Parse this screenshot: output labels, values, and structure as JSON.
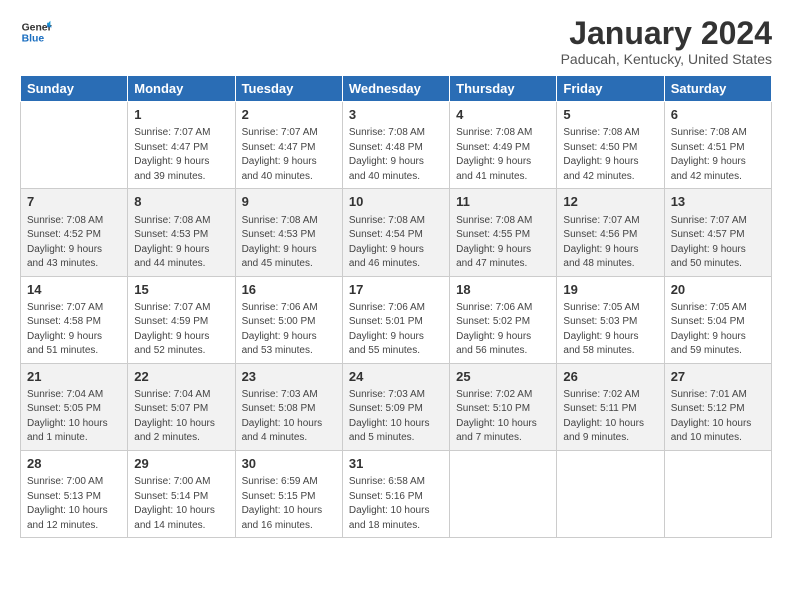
{
  "logo": {
    "line1": "General",
    "line2": "Blue"
  },
  "title": "January 2024",
  "subtitle": "Paducah, Kentucky, United States",
  "days_of_week": [
    "Sunday",
    "Monday",
    "Tuesday",
    "Wednesday",
    "Thursday",
    "Friday",
    "Saturday"
  ],
  "weeks": [
    [
      {
        "day": "",
        "content": ""
      },
      {
        "day": "1",
        "content": "Sunrise: 7:07 AM\nSunset: 4:47 PM\nDaylight: 9 hours\nand 39 minutes."
      },
      {
        "day": "2",
        "content": "Sunrise: 7:07 AM\nSunset: 4:47 PM\nDaylight: 9 hours\nand 40 minutes."
      },
      {
        "day": "3",
        "content": "Sunrise: 7:08 AM\nSunset: 4:48 PM\nDaylight: 9 hours\nand 40 minutes."
      },
      {
        "day": "4",
        "content": "Sunrise: 7:08 AM\nSunset: 4:49 PM\nDaylight: 9 hours\nand 41 minutes."
      },
      {
        "day": "5",
        "content": "Sunrise: 7:08 AM\nSunset: 4:50 PM\nDaylight: 9 hours\nand 42 minutes."
      },
      {
        "day": "6",
        "content": "Sunrise: 7:08 AM\nSunset: 4:51 PM\nDaylight: 9 hours\nand 42 minutes."
      }
    ],
    [
      {
        "day": "7",
        "content": "Sunrise: 7:08 AM\nSunset: 4:52 PM\nDaylight: 9 hours\nand 43 minutes."
      },
      {
        "day": "8",
        "content": "Sunrise: 7:08 AM\nSunset: 4:53 PM\nDaylight: 9 hours\nand 44 minutes."
      },
      {
        "day": "9",
        "content": "Sunrise: 7:08 AM\nSunset: 4:53 PM\nDaylight: 9 hours\nand 45 minutes."
      },
      {
        "day": "10",
        "content": "Sunrise: 7:08 AM\nSunset: 4:54 PM\nDaylight: 9 hours\nand 46 minutes."
      },
      {
        "day": "11",
        "content": "Sunrise: 7:08 AM\nSunset: 4:55 PM\nDaylight: 9 hours\nand 47 minutes."
      },
      {
        "day": "12",
        "content": "Sunrise: 7:07 AM\nSunset: 4:56 PM\nDaylight: 9 hours\nand 48 minutes."
      },
      {
        "day": "13",
        "content": "Sunrise: 7:07 AM\nSunset: 4:57 PM\nDaylight: 9 hours\nand 50 minutes."
      }
    ],
    [
      {
        "day": "14",
        "content": "Sunrise: 7:07 AM\nSunset: 4:58 PM\nDaylight: 9 hours\nand 51 minutes."
      },
      {
        "day": "15",
        "content": "Sunrise: 7:07 AM\nSunset: 4:59 PM\nDaylight: 9 hours\nand 52 minutes."
      },
      {
        "day": "16",
        "content": "Sunrise: 7:06 AM\nSunset: 5:00 PM\nDaylight: 9 hours\nand 53 minutes."
      },
      {
        "day": "17",
        "content": "Sunrise: 7:06 AM\nSunset: 5:01 PM\nDaylight: 9 hours\nand 55 minutes."
      },
      {
        "day": "18",
        "content": "Sunrise: 7:06 AM\nSunset: 5:02 PM\nDaylight: 9 hours\nand 56 minutes."
      },
      {
        "day": "19",
        "content": "Sunrise: 7:05 AM\nSunset: 5:03 PM\nDaylight: 9 hours\nand 58 minutes."
      },
      {
        "day": "20",
        "content": "Sunrise: 7:05 AM\nSunset: 5:04 PM\nDaylight: 9 hours\nand 59 minutes."
      }
    ],
    [
      {
        "day": "21",
        "content": "Sunrise: 7:04 AM\nSunset: 5:05 PM\nDaylight: 10 hours\nand 1 minute."
      },
      {
        "day": "22",
        "content": "Sunrise: 7:04 AM\nSunset: 5:07 PM\nDaylight: 10 hours\nand 2 minutes."
      },
      {
        "day": "23",
        "content": "Sunrise: 7:03 AM\nSunset: 5:08 PM\nDaylight: 10 hours\nand 4 minutes."
      },
      {
        "day": "24",
        "content": "Sunrise: 7:03 AM\nSunset: 5:09 PM\nDaylight: 10 hours\nand 5 minutes."
      },
      {
        "day": "25",
        "content": "Sunrise: 7:02 AM\nSunset: 5:10 PM\nDaylight: 10 hours\nand 7 minutes."
      },
      {
        "day": "26",
        "content": "Sunrise: 7:02 AM\nSunset: 5:11 PM\nDaylight: 10 hours\nand 9 minutes."
      },
      {
        "day": "27",
        "content": "Sunrise: 7:01 AM\nSunset: 5:12 PM\nDaylight: 10 hours\nand 10 minutes."
      }
    ],
    [
      {
        "day": "28",
        "content": "Sunrise: 7:00 AM\nSunset: 5:13 PM\nDaylight: 10 hours\nand 12 minutes."
      },
      {
        "day": "29",
        "content": "Sunrise: 7:00 AM\nSunset: 5:14 PM\nDaylight: 10 hours\nand 14 minutes."
      },
      {
        "day": "30",
        "content": "Sunrise: 6:59 AM\nSunset: 5:15 PM\nDaylight: 10 hours\nand 16 minutes."
      },
      {
        "day": "31",
        "content": "Sunrise: 6:58 AM\nSunset: 5:16 PM\nDaylight: 10 hours\nand 18 minutes."
      },
      {
        "day": "",
        "content": ""
      },
      {
        "day": "",
        "content": ""
      },
      {
        "day": "",
        "content": ""
      }
    ]
  ]
}
